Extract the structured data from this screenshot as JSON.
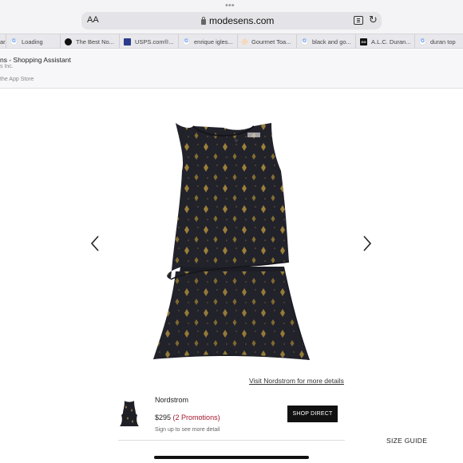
{
  "browser": {
    "text_size_label": "AA",
    "url": "modesens.com",
    "icons": [
      "more-dots-icon",
      "lock-icon",
      "reader-view-icon",
      "reload-icon"
    ]
  },
  "tabs": [
    {
      "label": "ar",
      "favicon": "partial-tab"
    },
    {
      "label": "Loading",
      "favicon": "google-icon"
    },
    {
      "label": "The Best No...",
      "favicon": "dark-circle-icon"
    },
    {
      "label": "USPS.com®...",
      "favicon": "usps-icon"
    },
    {
      "label": "enrique igles...",
      "favicon": "google-icon"
    },
    {
      "label": "Gourmet Toa...",
      "favicon": "gourmet-icon"
    },
    {
      "label": "black and go...",
      "favicon": "google-icon"
    },
    {
      "label": "A.L.C. Duran...",
      "favicon": "alc-icon"
    },
    {
      "label": "duran top",
      "favicon": "google-icon"
    }
  ],
  "banner": {
    "title": "ns - Shopping Assistant",
    "subtitle": "s Inc.",
    "store_text": "the App Store"
  },
  "product": {
    "image_icon": "sleeveless-top-image",
    "prev_icon": "chevron-left-icon",
    "next_icon": "chevron-right-icon",
    "visit_link": "Visit Nordstrom for more details"
  },
  "offer": {
    "retailer": "Nordstrom",
    "price": "$295",
    "promotions": "(2 Promotions)",
    "signup": "Sign up to see more detail",
    "button": "SHOP DIRECT"
  },
  "size_guide": "SIZE GUIDE",
  "colors": {
    "promo": "#a3172d",
    "button_bg": "#111111",
    "garment": "#1f1f27",
    "gold": "#a8893a"
  }
}
